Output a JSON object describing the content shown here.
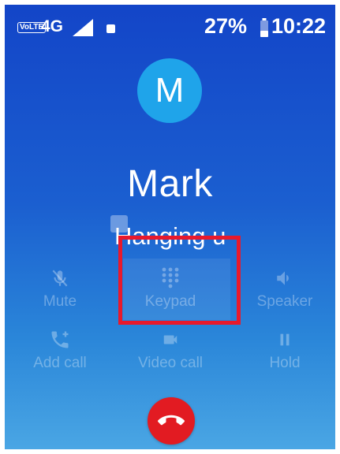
{
  "status_bar": {
    "volte_label": "VoLTE",
    "network_label": "4G",
    "battery_percent": "27%",
    "time": "10:22",
    "icons": [
      "signal-icon",
      "sim-notification-icon",
      "battery-icon"
    ]
  },
  "contact": {
    "avatar_letter": "M",
    "name": "Mark",
    "status": "Hanging u",
    "avatar_color": "#1fa4ea"
  },
  "controls": {
    "mute": {
      "label": "Mute",
      "icon": "microphone-off-icon"
    },
    "keypad": {
      "label": "Keypad",
      "icon": "dialpad-icon"
    },
    "speaker": {
      "label": "Speaker",
      "icon": "speaker-icon"
    },
    "add_call": {
      "label": "Add call",
      "icon": "add-call-icon"
    },
    "video_call": {
      "label": "Video call",
      "icon": "video-camera-icon"
    },
    "hold": {
      "label": "Hold",
      "icon": "pause-icon"
    }
  },
  "end_call": {
    "icon": "end-call-icon",
    "color": "#e21b22"
  },
  "highlight": {
    "target": "keypad",
    "color": "#e8192c"
  }
}
